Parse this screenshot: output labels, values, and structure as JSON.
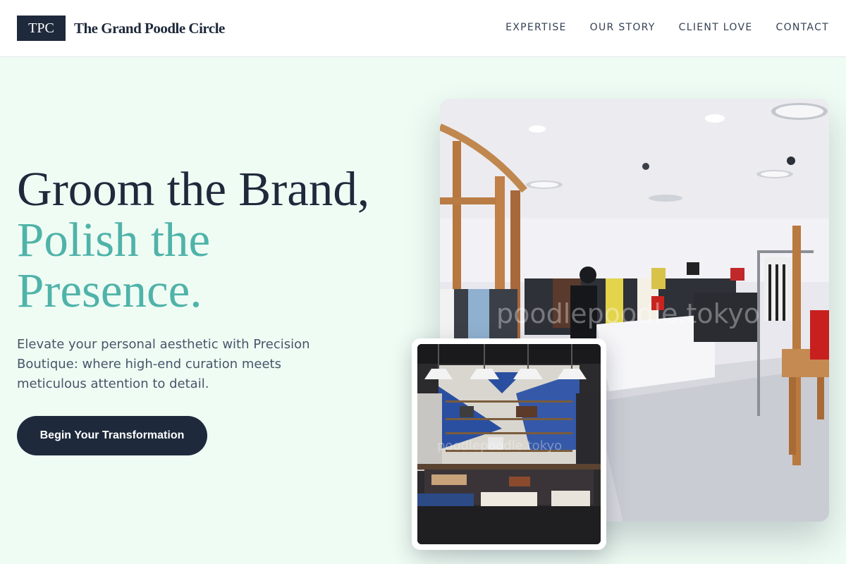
{
  "header": {
    "logo_text": "TPC",
    "brand_name": "The Grand Poodle Circle",
    "nav": [
      {
        "label": "EXPERTISE"
      },
      {
        "label": "OUR STORY"
      },
      {
        "label": "CLIENT LOVE"
      },
      {
        "label": "CONTACT"
      }
    ]
  },
  "hero": {
    "headline_line1": "Groom the Brand,",
    "headline_line2": "Polish the",
    "headline_line3": "Presence.",
    "subtext": "Elevate your personal aesthetic with Precision Boutique: where high-end curation meets meticulous attention to detail.",
    "cta_label": "Begin Your Transformation"
  },
  "images": {
    "main_watermark": "poodlepoodle.tokyo",
    "inset_watermark": "poodlepoodle.tokyo"
  },
  "colors": {
    "navy": "#1e293b",
    "teal_accent": "#4fb3a9",
    "background": "#effcf4"
  }
}
